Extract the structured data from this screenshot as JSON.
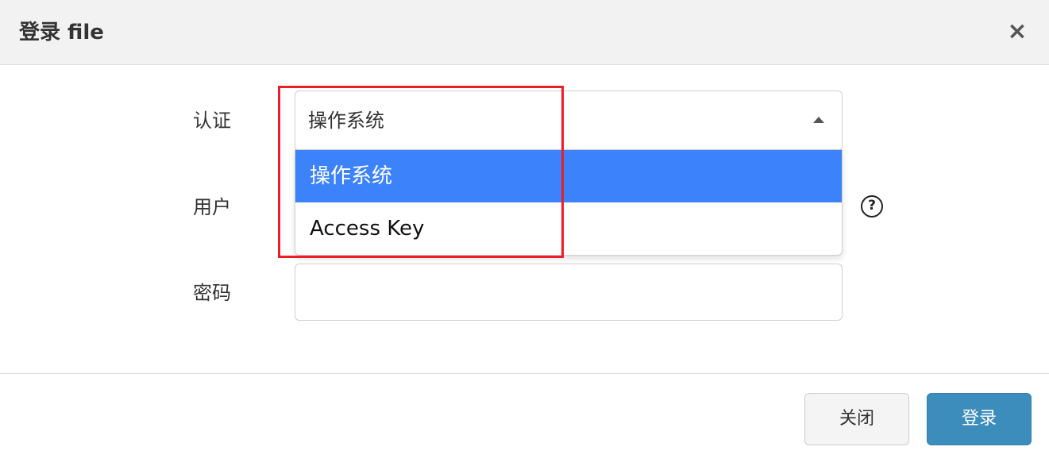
{
  "dialog": {
    "title": "登录 file",
    "close_glyph": "×"
  },
  "form": {
    "auth_label": "认证",
    "auth_selected": "操作系统",
    "auth_options": [
      "操作系统",
      "Access Key"
    ],
    "user_label": "用户",
    "password_label": "密码",
    "password_value": "",
    "help_glyph": "?"
  },
  "footer": {
    "close_label": "关闭",
    "login_label": "登录"
  },
  "colors": {
    "primary": "#3c8dbc",
    "option_highlight": "#3c82fb",
    "annotation_box": "#ee1c25"
  }
}
